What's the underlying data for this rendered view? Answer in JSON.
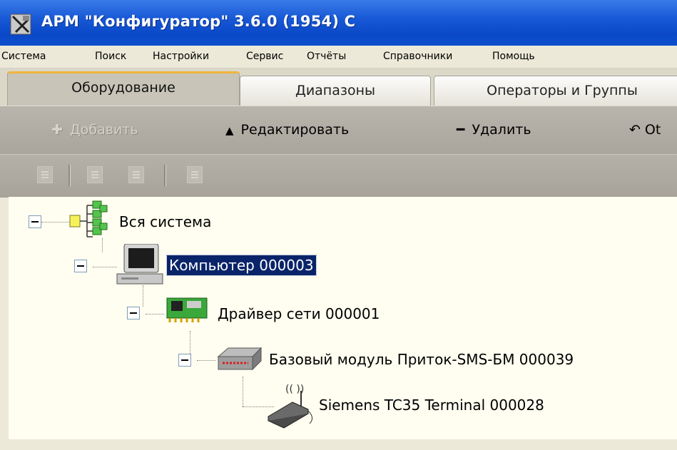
{
  "window": {
    "title": "АРМ \"Конфигуратор\"  3.6.0 (1954) С"
  },
  "menu": [
    "Система",
    "Поиск",
    "Настройки",
    "Сервис",
    "Отчёты",
    "Справочники",
    "Помощь"
  ],
  "tabs": [
    {
      "label": "Оборудование",
      "active": true
    },
    {
      "label": "Диапазоны",
      "active": false
    },
    {
      "label": "Операторы и Группы",
      "active": false
    }
  ],
  "actions": {
    "add": "Добавить",
    "edit": "Редактировать",
    "delete": "Удалить",
    "cancel": "Оt"
  },
  "tree": {
    "root": "Вся система",
    "computer": "Компьютер 000003",
    "driver": "Драйвер сети 000001",
    "module": "Базовый модуль Приток-SMS-БМ 000039",
    "terminal": "Siemens TC35 Terminal 000028"
  },
  "colors": {
    "titlebar": "#0a48c8",
    "selection": "#0a246a",
    "tree_bg": "#fffef0",
    "active_tab_accent": "#f1b43c"
  }
}
